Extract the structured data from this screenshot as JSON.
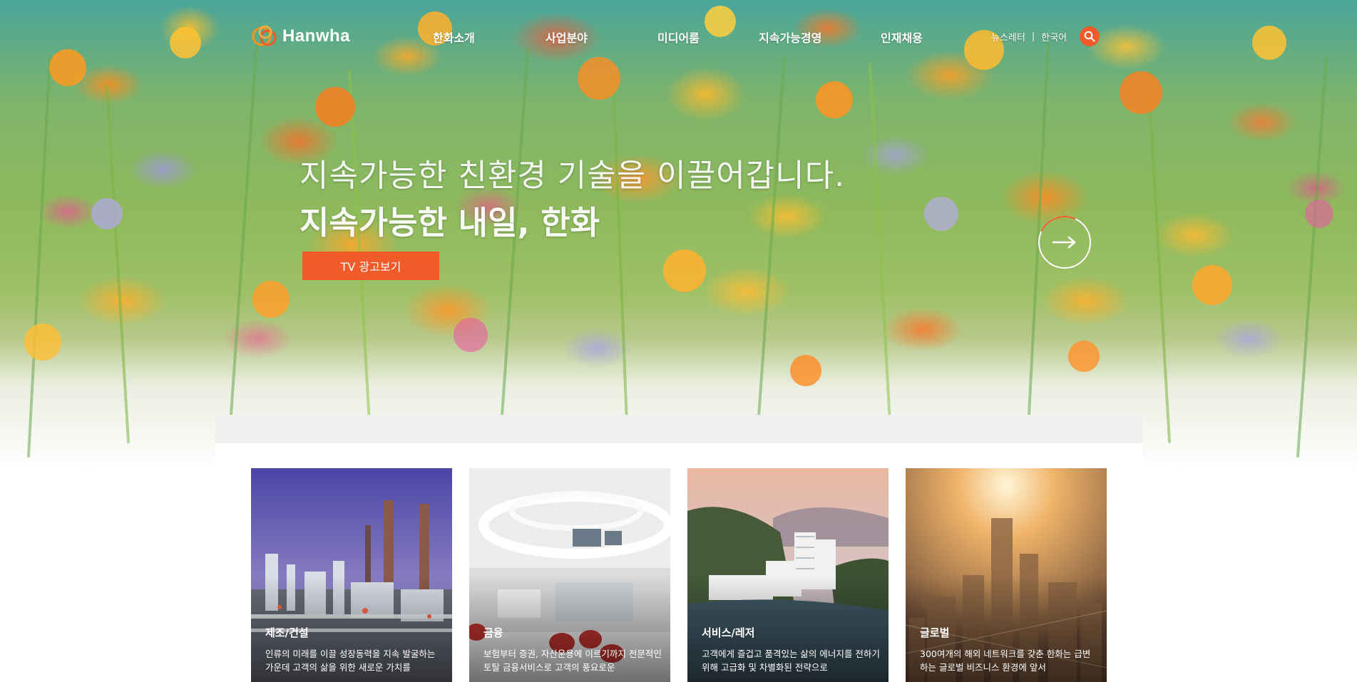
{
  "brand": {
    "name": "Hanwha",
    "accent": "#f15a29"
  },
  "nav": {
    "items": [
      {
        "label": "한화소개"
      },
      {
        "label": "사업분야"
      },
      {
        "label": "미디어룸"
      },
      {
        "label": "지속가능경영"
      },
      {
        "label": "인재채용"
      }
    ]
  },
  "utility": {
    "newsletter": "뉴스레터",
    "separator": "|",
    "language": "한국어",
    "search_icon": "search-icon"
  },
  "hero": {
    "subtitle": "지속가능한 친환경 기술을 이끌어갑니다.",
    "title": "지속가능한 내일, 한화",
    "cta_label": "TV 광고보기",
    "next_icon": "arrow-right-icon"
  },
  "business": {
    "cards": [
      {
        "title": "제조/건설",
        "desc": "인류의 미래를 이끌 성장동력을 지속 발굴하는 가운데 고객의 삶을 위한 새로운 가치를"
      },
      {
        "title": "금융",
        "desc": "보험부터 증권, 자산운용에 이르기까지 전문적인 토탈 금융서비스로 고객의 풍요로운"
      },
      {
        "title": "서비스/레저",
        "desc": "고객에게 즐겁고 품격있는 삶의 에너지를 전하기 위해 고급화 및 차별화된 전략으로"
      },
      {
        "title": "글로벌",
        "desc": "300여개의 해외 네트워크를 갖춘 한화는 급변하는 글로벌 비즈니스 환경에 앞서"
      }
    ]
  }
}
